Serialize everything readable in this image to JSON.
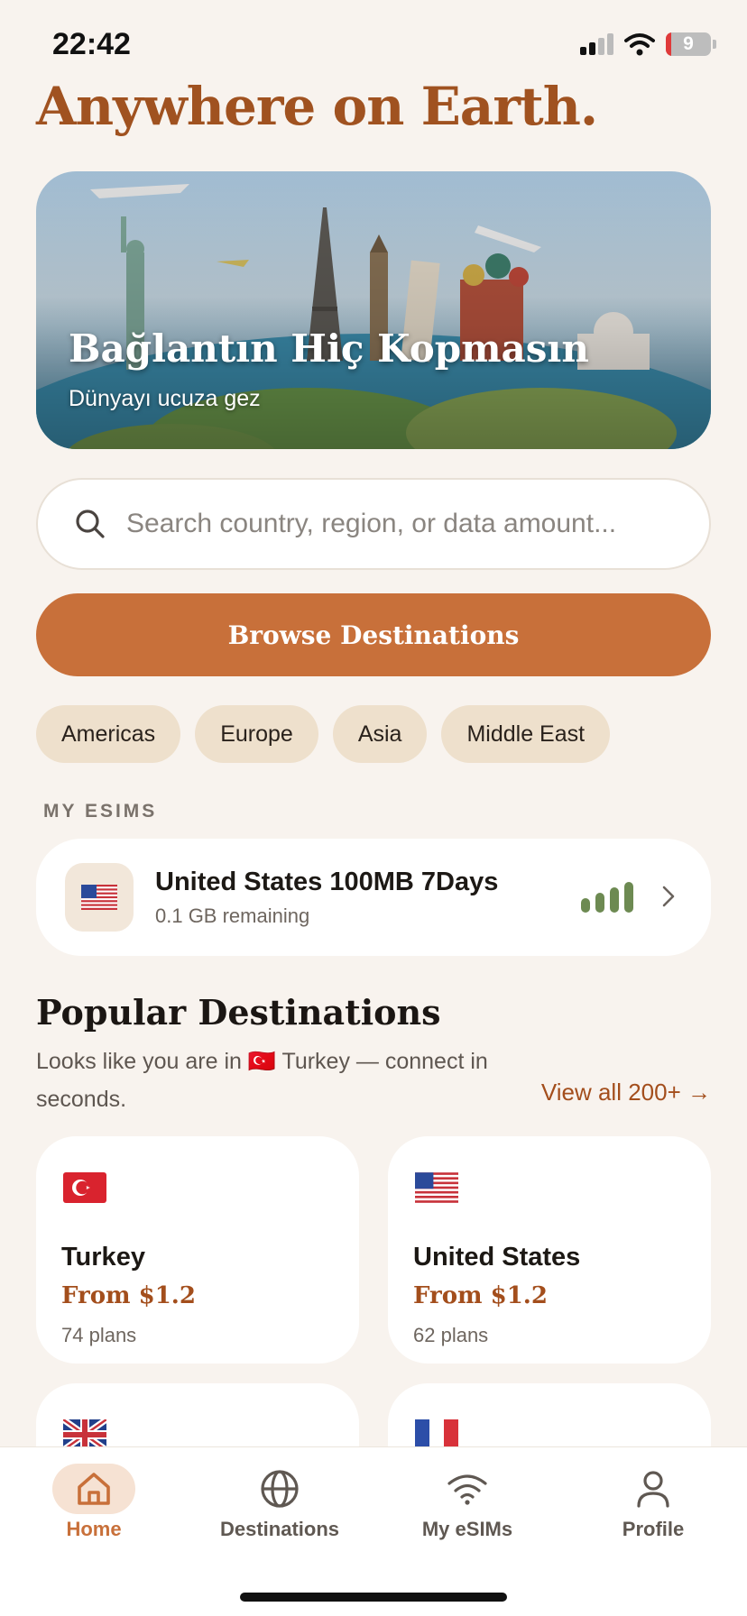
{
  "status_bar": {
    "time": "22:42",
    "battery_level": "9"
  },
  "hero": {
    "title": "Anywhere on Earth."
  },
  "banner": {
    "title": "Bağlantın Hiç Kopmasın",
    "subtitle": "Dünyayı ucuza gez"
  },
  "search": {
    "placeholder": "Search country, region, or data amount..."
  },
  "browse_button": {
    "label": "Browse Destinations"
  },
  "regions": [
    "Americas",
    "Europe",
    "Asia",
    "Middle East"
  ],
  "my_esims": {
    "section_label": "MY ESIMS",
    "items": [
      {
        "name": "United States 100MB 7Days",
        "remaining": "0.1 GB remaining",
        "flag": "us-flag",
        "signal_level": 0.8
      }
    ]
  },
  "popular": {
    "title": "Popular Destinations",
    "description": "Looks like you are in 🇹🇷 Turkey — connect in seconds.",
    "view_all": "View all 200+ →",
    "cards": [
      {
        "name": "Turkey",
        "price": "From $1.2",
        "plans": "74 plans",
        "flag": "tr-flag"
      },
      {
        "name": "United States",
        "price": "From $1.2",
        "plans": "62 plans",
        "flag": "us-flag"
      },
      {
        "name": "",
        "price": "",
        "plans": "",
        "flag": "gb-flag"
      },
      {
        "name": "",
        "price": "",
        "plans": "",
        "flag": "fr-flag"
      }
    ]
  },
  "tabs": [
    {
      "label": "Home",
      "icon": "home-icon",
      "active": true
    },
    {
      "label": "Destinations",
      "icon": "globe-icon",
      "active": false
    },
    {
      "label": "My eSIMs",
      "icon": "wifi-icon",
      "active": false
    },
    {
      "label": "Profile",
      "icon": "person-icon",
      "active": false
    }
  ],
  "colors": {
    "accent": "#c8703a",
    "title_brown": "#a05220",
    "signal_green": "#6d8a52",
    "background": "#f8f3ee"
  }
}
